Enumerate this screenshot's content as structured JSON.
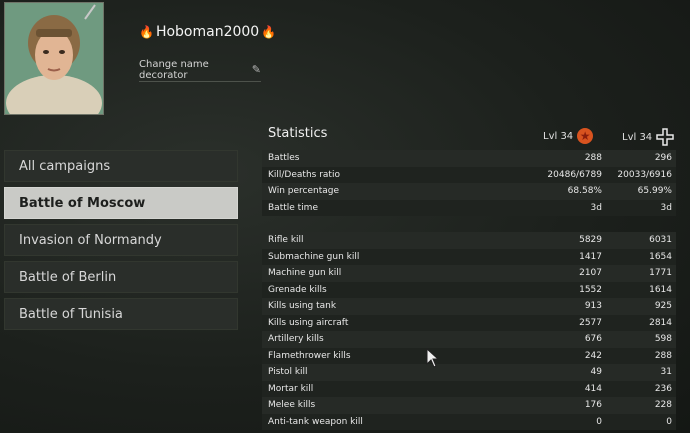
{
  "profile": {
    "username": "Hoboman2000",
    "flame_glyph": "🔥",
    "decorator_label": "Change name decorator",
    "pencil_icon": "pencil-icon"
  },
  "campaigns": [
    {
      "label": "All campaigns",
      "active": false
    },
    {
      "label": "Battle of Moscow",
      "active": true
    },
    {
      "label": "Invasion of Normandy",
      "active": false
    },
    {
      "label": "Battle of Berlin",
      "active": false
    },
    {
      "label": "Battle of Tunisia",
      "active": false
    }
  ],
  "stats": {
    "title": "Statistics",
    "col1_level": "Lvl 34",
    "col2_level": "Lvl 34",
    "col1_icon": "soviet-star-icon",
    "col2_icon": "german-cross-icon",
    "summary": [
      {
        "label": "Battles",
        "v1": "288",
        "v2": "296"
      },
      {
        "label": "Kill/Deaths ratio",
        "v1": "20486/6789",
        "v2": "20033/6916"
      },
      {
        "label": "Win percentage",
        "v1": "68.58%",
        "v2": "65.99%"
      },
      {
        "label": "Battle time",
        "v1": "3d",
        "v2": "3d"
      }
    ],
    "kills": [
      {
        "label": "Rifle kill",
        "v1": "5829",
        "v2": "6031"
      },
      {
        "label": "Submachine gun kill",
        "v1": "1417",
        "v2": "1654"
      },
      {
        "label": "Machine gun kill",
        "v1": "2107",
        "v2": "1771"
      },
      {
        "label": "Grenade kills",
        "v1": "1552",
        "v2": "1614"
      },
      {
        "label": "Kills using tank",
        "v1": "913",
        "v2": "925"
      },
      {
        "label": "Kills using aircraft",
        "v1": "2577",
        "v2": "2814"
      },
      {
        "label": "Artillery kills",
        "v1": "676",
        "v2": "598"
      },
      {
        "label": "Flamethrower kills",
        "v1": "242",
        "v2": "288"
      },
      {
        "label": "Pistol kill",
        "v1": "49",
        "v2": "31"
      },
      {
        "label": "Mortar kill",
        "v1": "414",
        "v2": "236"
      },
      {
        "label": "Melee kills",
        "v1": "176",
        "v2": "228"
      },
      {
        "label": "Anti-tank weapon kill",
        "v1": "0",
        "v2": "0"
      }
    ]
  }
}
